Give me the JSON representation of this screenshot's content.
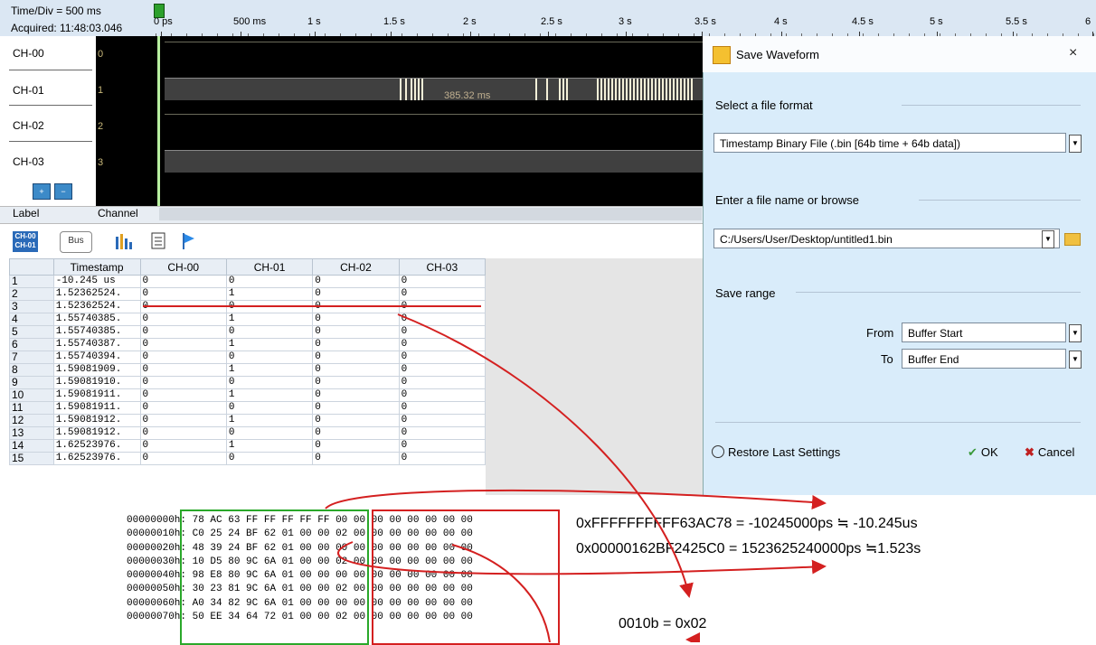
{
  "waveform": {
    "time_div": "Time/Div = 500 ms",
    "acquired": "Acquired: 11:48:03.046",
    "ruler_labels": [
      "0 ps",
      "500 ms",
      "1 s",
      "1.5 s",
      "2 s",
      "2.5 s",
      "3 s",
      "3.5 s",
      "4 s",
      "4.5 s",
      "5 s",
      "5.5 s",
      "6"
    ],
    "channels": [
      {
        "name": "CH-00",
        "index": "0"
      },
      {
        "name": "CH-01",
        "index": "1"
      },
      {
        "name": "CH-02",
        "index": "2"
      },
      {
        "name": "CH-03",
        "index": "3"
      }
    ],
    "pulse_label": "385.32 ms",
    "col_label": "Label",
    "col_channel": "Channel"
  },
  "toolbar": {
    "ch_icon_top": "CH-00",
    "ch_icon_bottom": "CH-01",
    "bus_label": "Bus"
  },
  "table": {
    "headers": [
      "",
      "Timestamp",
      "CH-00",
      "CH-01",
      "CH-02",
      "CH-03"
    ],
    "rows": [
      [
        "1",
        "-10.245 us",
        "0",
        "0",
        "0",
        "0"
      ],
      [
        "2",
        "1.52362524.",
        "0",
        "1",
        "0",
        "0"
      ],
      [
        "3",
        "1.52362524.",
        "0",
        "0",
        "0",
        "0"
      ],
      [
        "4",
        "1.55740385.",
        "0",
        "1",
        "0",
        "0"
      ],
      [
        "5",
        "1.55740385.",
        "0",
        "0",
        "0",
        "0"
      ],
      [
        "6",
        "1.55740387.",
        "0",
        "1",
        "0",
        "0"
      ],
      [
        "7",
        "1.55740394.",
        "0",
        "0",
        "0",
        "0"
      ],
      [
        "8",
        "1.59081909.",
        "0",
        "1",
        "0",
        "0"
      ],
      [
        "9",
        "1.59081910.",
        "0",
        "0",
        "0",
        "0"
      ],
      [
        "10",
        "1.59081911.",
        "0",
        "1",
        "0",
        "0"
      ],
      [
        "11",
        "1.59081911.",
        "0",
        "0",
        "0",
        "0"
      ],
      [
        "12",
        "1.59081912.",
        "0",
        "1",
        "0",
        "0"
      ],
      [
        "13",
        "1.59081912.",
        "0",
        "0",
        "0",
        "0"
      ],
      [
        "14",
        "1.62523976.",
        "0",
        "1",
        "0",
        "0"
      ],
      [
        "15",
        "1.62523976.",
        "0",
        "0",
        "0",
        "0"
      ]
    ]
  },
  "dialog": {
    "title": "Save Waveform",
    "close": "×",
    "format_label": "Select a file format",
    "format_value": "Timestamp Binary File (.bin [64b time + 64b data])",
    "filename_label": "Enter a file name or browse",
    "filename_value": "C:/Users/User/Desktop/untitled1.bin",
    "range_label": "Save range",
    "from_label": "From",
    "from_value": "Buffer Start",
    "to_label": "To",
    "to_value": "Buffer End",
    "restore": "Restore Last Settings",
    "ok": "OK",
    "cancel": "Cancel",
    "ok_color": "#3a9a3a",
    "cancel_color": "#c02020"
  },
  "hex": {
    "rows": [
      {
        "addr": "00000000h:",
        "left": "78 AC 63 FF FF FF FF FF",
        "right": "00 00 00 00 00 00 00 00"
      },
      {
        "addr": "00000010h:",
        "left": "C0 25 24 BF 62 01 00 00",
        "right": "02 00 00 00 00 00 00 00"
      },
      {
        "addr": "00000020h:",
        "left": "48 39 24 BF 62 01 00 00",
        "right": "00 00 00 00 00 00 00 00"
      },
      {
        "addr": "00000030h:",
        "left": "10 D5 80 9C 6A 01 00 00",
        "right": "02 00 00 00 00 00 00 00"
      },
      {
        "addr": "00000040h:",
        "left": "98 E8 80 9C 6A 01 00 00",
        "right": "00 00 00 00 00 00 00 00"
      },
      {
        "addr": "00000050h:",
        "left": "30 23 81 9C 6A 01 00 00",
        "right": "02 00 00 00 00 00 00 00"
      },
      {
        "addr": "00000060h:",
        "left": "A0 34 82 9C 6A 01 00 00",
        "right": "00 00 00 00 00 00 00 00"
      },
      {
        "addr": "00000070h:",
        "left": "50 EE 34 64 72 01 00 00",
        "right": "02 00 00 00 00 00 00 00"
      }
    ]
  },
  "annotations": {
    "line1": "0xFFFFFFFFFF63AC78 = -10245000ps ≒ -10.245us",
    "line2": "0x00000162BF2425C0 = 1523625240000ps ≒1.523s",
    "line3": "0010b = 0x02"
  },
  "colors": {
    "accent_red": "#d42020",
    "accent_green": "#2aa82a",
    "dialog_bg": "#d9ecfa"
  }
}
